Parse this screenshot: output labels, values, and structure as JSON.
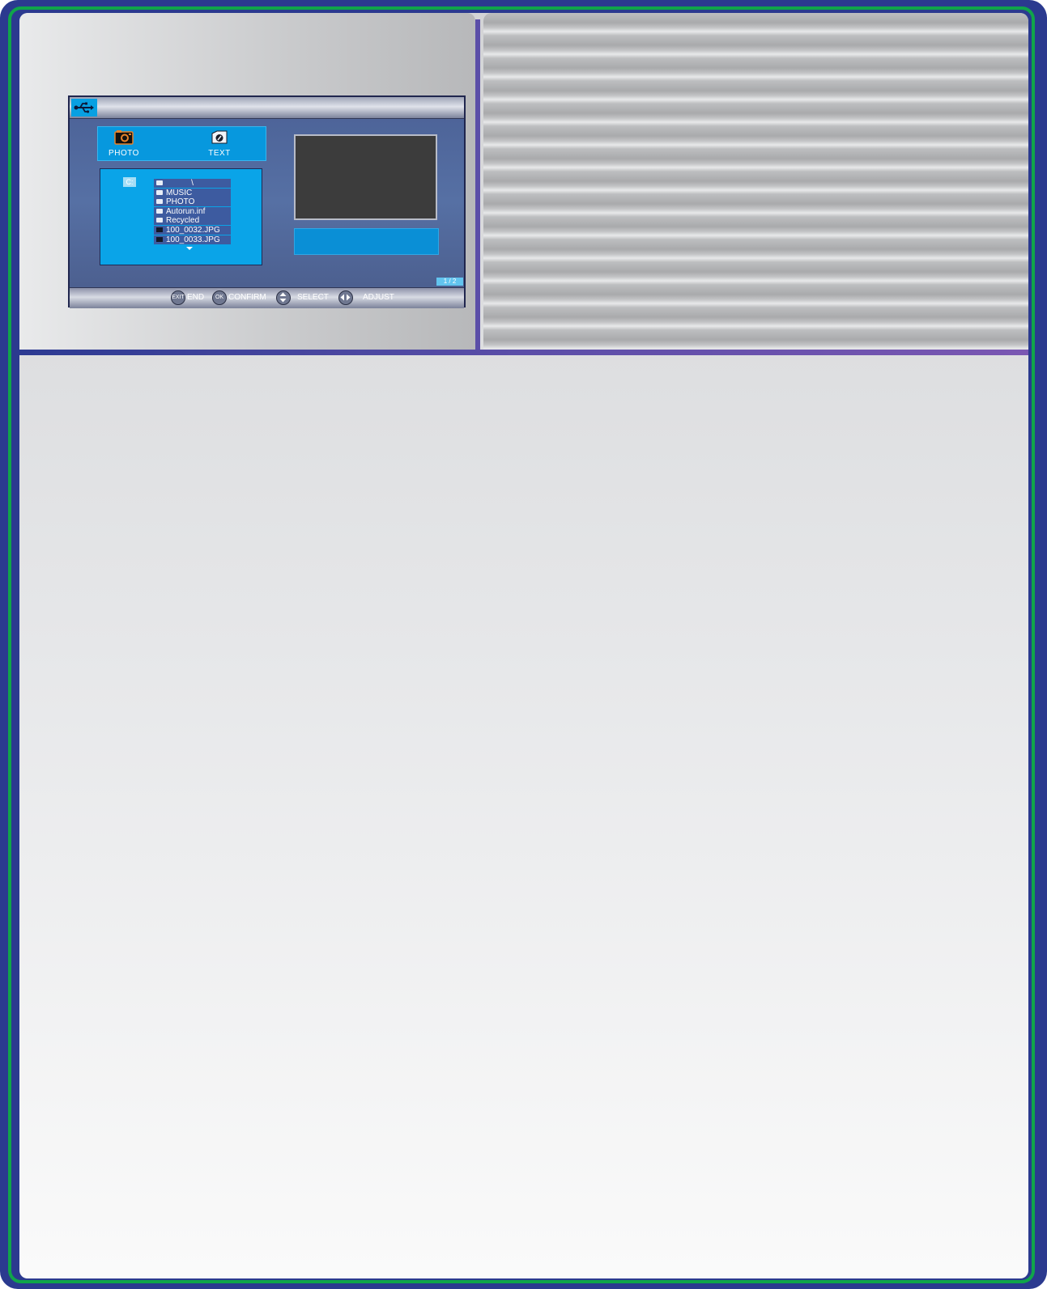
{
  "osd": {
    "tabs": [
      {
        "label": "PHOTO",
        "icon": "camera-icon"
      },
      {
        "label": "TEXT",
        "icon": "text-file-icon"
      }
    ],
    "drive": "C:",
    "files": [
      {
        "name": "\\",
        "type": "folder"
      },
      {
        "name": "MUSIC",
        "type": "folder"
      },
      {
        "name": "PHOTO",
        "type": "folder"
      },
      {
        "name": "Autorun.inf",
        "type": "folder"
      },
      {
        "name": "Recycled",
        "type": "folder"
      },
      {
        "name": "100_0032.JPG",
        "type": "image"
      },
      {
        "name": "100_0033.JPG",
        "type": "image"
      }
    ],
    "page": "1 / 2",
    "footer": {
      "exit_key": "EXIT",
      "exit_label": "END",
      "ok_key": "OK",
      "ok_label": "CONFIRM",
      "select_label": "SELECT",
      "adjust_label": "ADJUST"
    }
  },
  "colors": {
    "outer_frame": "#2b3a8f",
    "frame_border": "#10a54a",
    "accent_blue": "#0aa4e8",
    "divider": "#5b4ea8"
  }
}
